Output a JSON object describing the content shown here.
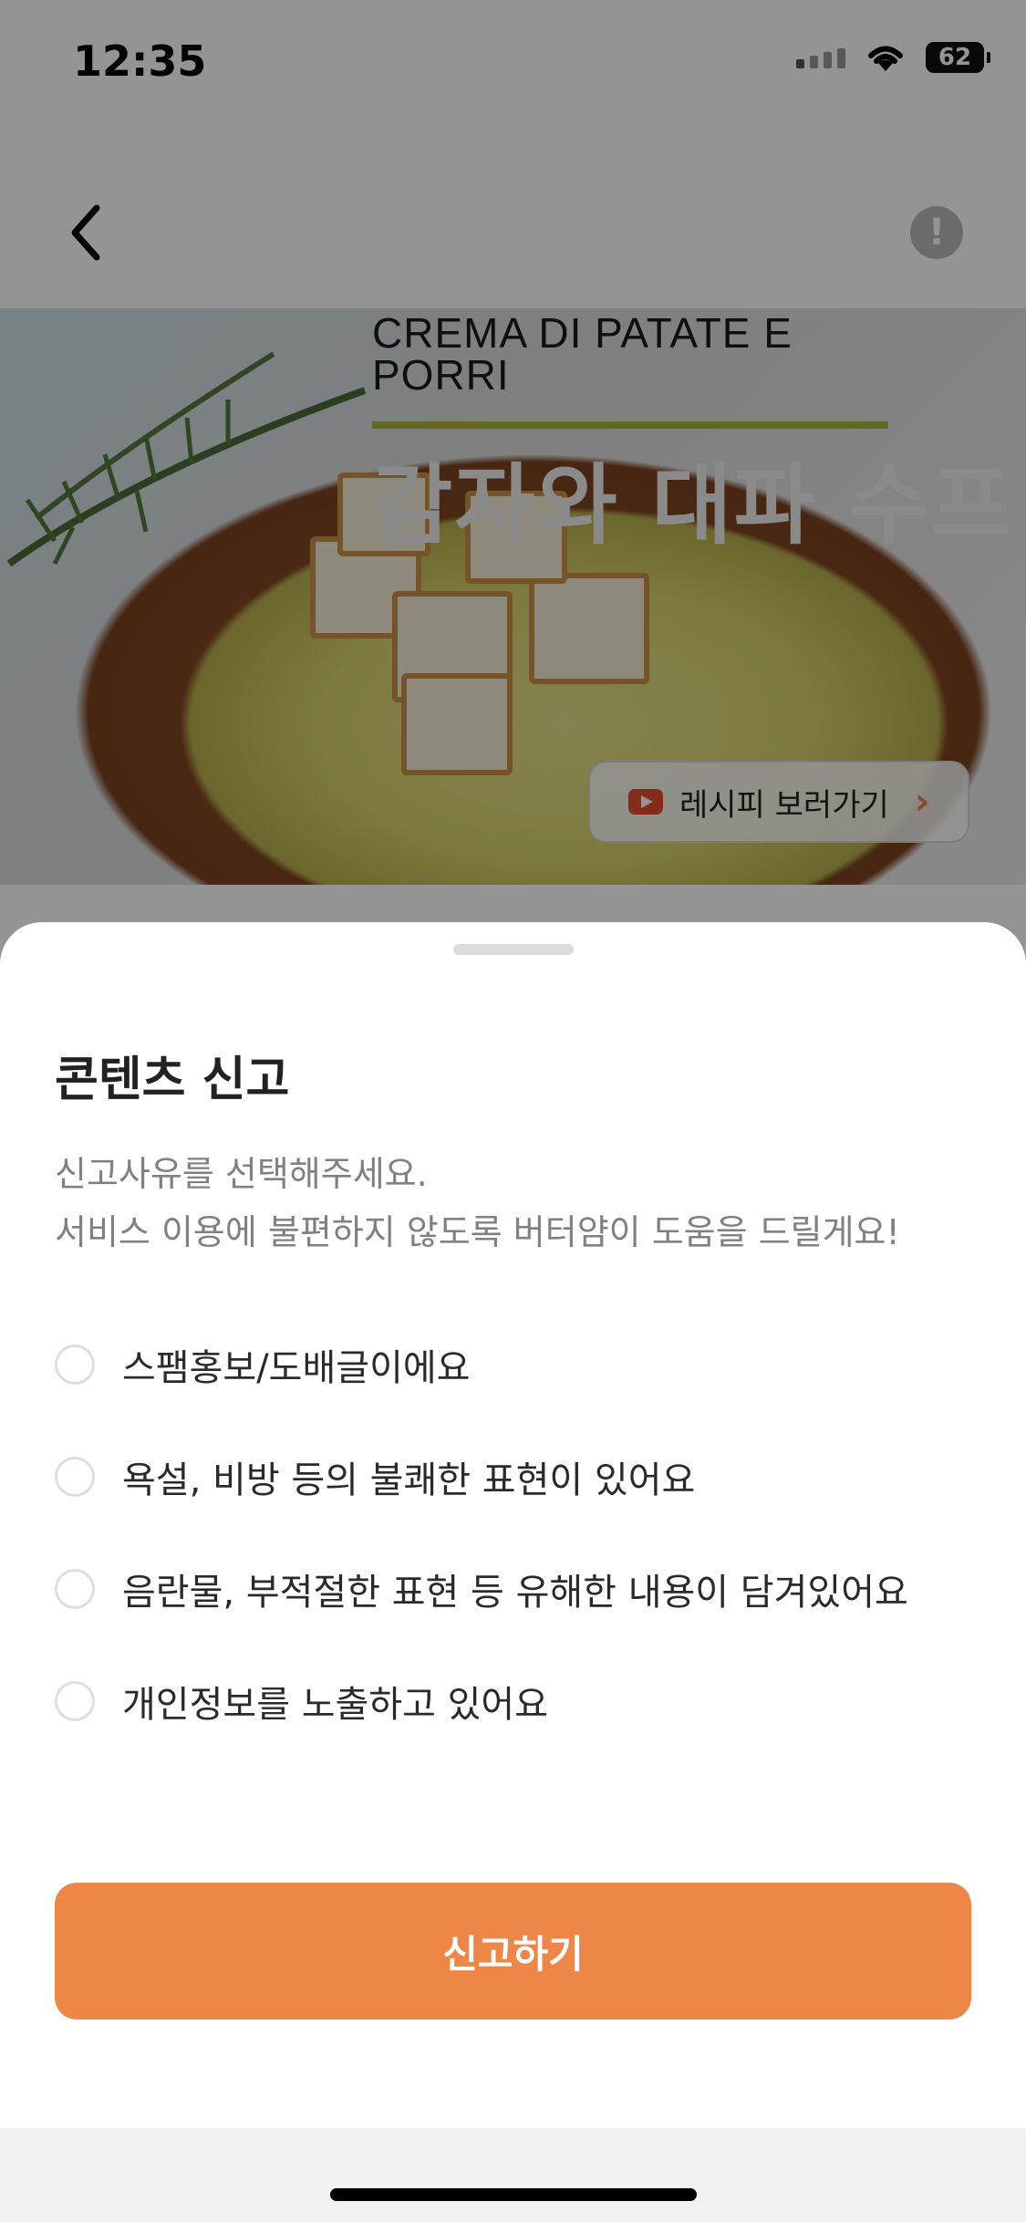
{
  "status_bar": {
    "time": "12:35",
    "battery": "62"
  },
  "hero": {
    "title_en": "CREMA DI PATATE E PORRI",
    "title_ko": "감자와 대파 수프",
    "recipe_button": "레시피 보러가기"
  },
  "sheet": {
    "title": "콘텐츠 신고",
    "description_line1": "신고사유를 선택해주세요.",
    "description_line2": "서비스 이용에 불편하지 않도록 버터얌이 도움을 드릴게요!",
    "options": [
      {
        "label": "스팸홍보/도배글이에요",
        "selected": false
      },
      {
        "label": "욕설, 비방 등의 불쾌한 표현이 있어요",
        "selected": false
      },
      {
        "label": "음란물, 부적절한 표현 등 유해한 내용이 담겨있어요",
        "selected": false
      },
      {
        "label": "개인정보를 노출하고 있어요",
        "selected": false
      }
    ],
    "submit_label": "신고하기"
  },
  "colors": {
    "accent": "#ee8648",
    "dim_overlay": "rgba(0,0,0,0.42)"
  },
  "icons": [
    "back-chevron-icon",
    "info-icon",
    "youtube-icon",
    "chevron-right-icon",
    "wifi-icon",
    "signal-icon",
    "battery-icon"
  ]
}
